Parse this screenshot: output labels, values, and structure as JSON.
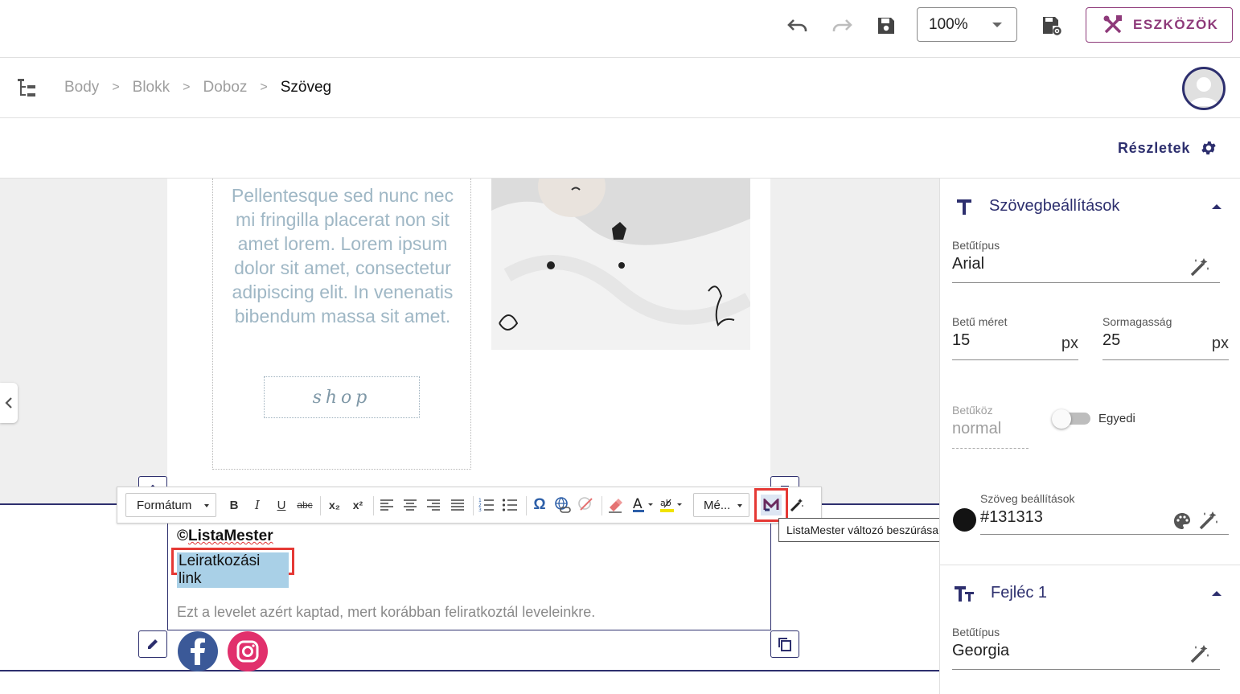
{
  "topbar": {
    "undo_icon": "undo-icon",
    "redo_icon": "redo-icon",
    "save_icon": "save-icon",
    "zoom": "100%",
    "save_settings_icon": "save-settings-icon",
    "tools_label": "ESZKÖZÖK",
    "tools_color": "#8e3a7a"
  },
  "breadcrumb": {
    "items": [
      "Body",
      "Blokk",
      "Doboz"
    ],
    "current": "Szöveg",
    "separator": ">"
  },
  "details": {
    "label": "Részletek",
    "accent": "#2d2f6e"
  },
  "canvas": {
    "body_text": "Pellentesque sed nunc nec mi fringilla placerat non sit amet lorem. Lorem ipsum dolor sit amet, consectetur adipiscing elit. In venenatis bibendum massa sit amet.",
    "shop_label": "shop",
    "footer_copyright_symbol": "©",
    "footer_brand": "ListaMester",
    "unsubscribe_link": "Leiratkozási link",
    "footer_note": "Ezt a levelet azért kaptad, mert korábban feliratkoztál leveleinkre."
  },
  "editor_toolbar": {
    "format_label": "Formátum",
    "more_label": "Mé...",
    "tooltip": "ListaMester változó beszúrása",
    "buttons": {
      "bold": "B",
      "italic": "I",
      "underline": "U",
      "strike": "abc",
      "subscript": "x₂",
      "superscript": "x²",
      "special_char": "Ω"
    }
  },
  "panel": {
    "text_settings": {
      "title": "Szövegbeállítások",
      "font_label": "Betűtípus",
      "font_value": "Arial",
      "size_label": "Betű méret",
      "size_value": "15",
      "size_unit": "px",
      "line_height_label": "Sormagasság",
      "line_height_value": "25",
      "line_height_unit": "px",
      "letter_spacing_label": "Betűköz",
      "letter_spacing_value": "normal",
      "custom_toggle_label": "Egyedi",
      "color_label": "Szöveg beállítások",
      "color_value": "#131313"
    },
    "heading1": {
      "title": "Fejléc 1",
      "font_label": "Betűtípus",
      "font_value": "Georgia"
    }
  }
}
